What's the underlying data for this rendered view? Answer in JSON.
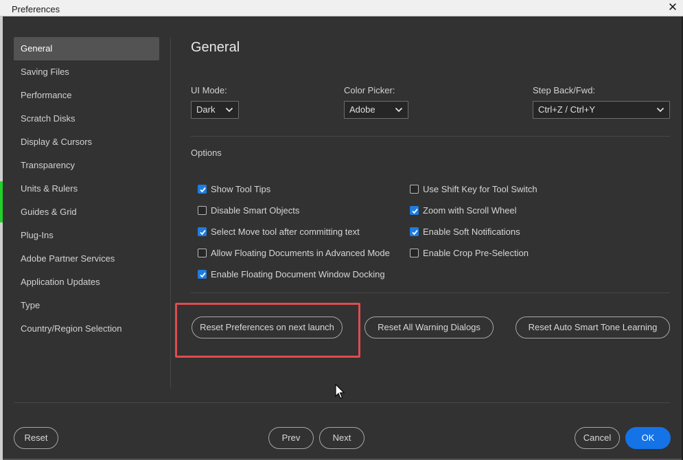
{
  "window": {
    "title": "Preferences",
    "close_glyph": "✕"
  },
  "sidebar": {
    "items": [
      {
        "label": "General",
        "active": true
      },
      {
        "label": "Saving Files"
      },
      {
        "label": "Performance"
      },
      {
        "label": "Scratch Disks"
      },
      {
        "label": "Display & Cursors"
      },
      {
        "label": "Transparency"
      },
      {
        "label": "Units & Rulers"
      },
      {
        "label": "Guides & Grid"
      },
      {
        "label": "Plug-Ins"
      },
      {
        "label": "Adobe Partner Services"
      },
      {
        "label": "Application Updates"
      },
      {
        "label": "Type"
      },
      {
        "label": "Country/Region Selection"
      }
    ]
  },
  "main": {
    "title": "General",
    "ui_mode": {
      "label": "UI Mode:",
      "value": "Dark"
    },
    "color_picker": {
      "label": "Color Picker:",
      "value": "Adobe"
    },
    "step_back": {
      "label": "Step Back/Fwd:",
      "value": "Ctrl+Z / Ctrl+Y"
    },
    "options_label": "Options",
    "options": [
      {
        "label": "Show Tool Tips",
        "checked": true
      },
      {
        "label": "Disable Smart Objects",
        "checked": false
      },
      {
        "label": "Select Move tool after committing text",
        "checked": true
      },
      {
        "label": "Allow Floating Documents in Advanced Mode",
        "checked": false
      },
      {
        "label": "Enable Floating Document Window Docking",
        "checked": true
      },
      {
        "label": "Use Shift Key for Tool Switch",
        "checked": false
      },
      {
        "label": "Zoom with Scroll Wheel",
        "checked": true
      },
      {
        "label": "Enable Soft Notifications",
        "checked": true
      },
      {
        "label": "Enable Crop Pre-Selection",
        "checked": false
      }
    ],
    "reset_prefs_label": "Reset Preferences on next launch",
    "reset_warnings_label": "Reset All Warning Dialogs",
    "reset_smart_tone_label": "Reset Auto Smart Tone Learning"
  },
  "footer": {
    "reset_label": "Reset",
    "prev_label": "Prev",
    "next_label": "Next",
    "cancel_label": "Cancel",
    "ok_label": "OK"
  },
  "colors": {
    "accent": "#1473e6",
    "checkbox": "#1e7de0",
    "highlight": "#e14b4f",
    "background": "#323232"
  },
  "icons": {
    "dropdown": "chevron-down-icon",
    "check": "checkmark-icon",
    "close": "close-icon",
    "cursor": "mouse-pointer-icon"
  }
}
